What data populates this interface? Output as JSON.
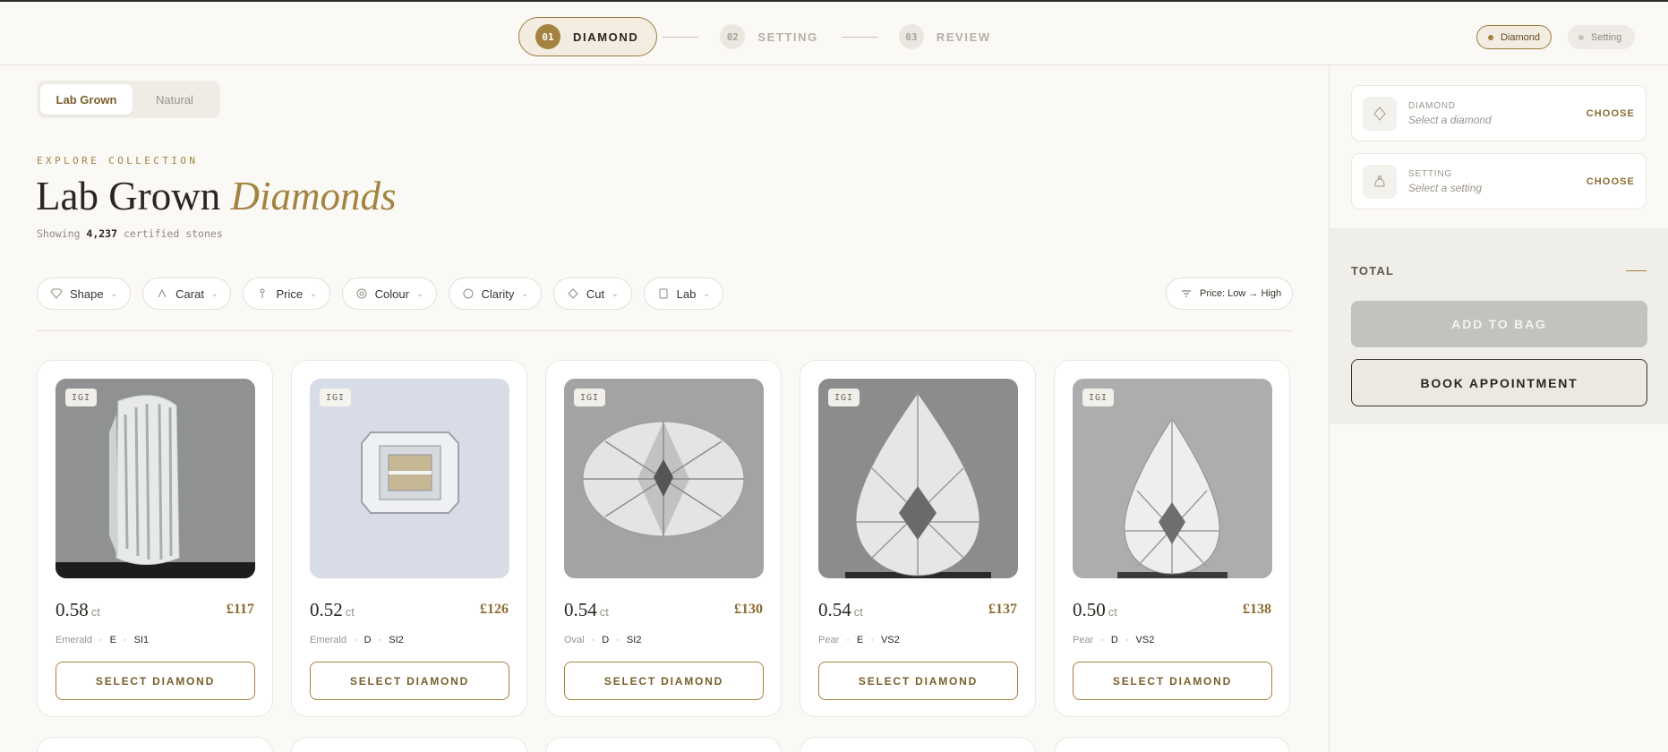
{
  "stepper": {
    "steps": [
      {
        "num": "01",
        "label": "DIAMOND"
      },
      {
        "num": "02",
        "label": "SETTING"
      },
      {
        "num": "03",
        "label": "REVIEW"
      }
    ]
  },
  "progress_pills": {
    "diamond": "Diamond",
    "setting": "Setting"
  },
  "type_toggle": {
    "lab": "Lab Grown",
    "natural": "Natural"
  },
  "header": {
    "eyebrow": "EXPLORE COLLECTION",
    "title_plain": "Lab Grown",
    "title_italic": "Diamonds",
    "subtitle_prefix": "Showing",
    "subtitle_count": "4,237",
    "subtitle_suffix": "certified stones"
  },
  "filters": [
    "Shape",
    "Carat",
    "Price",
    "Colour",
    "Clarity",
    "Cut",
    "Lab"
  ],
  "sort": {
    "label": "Price: Low → High"
  },
  "cards": [
    {
      "badge": "IGI",
      "carat": "0.58",
      "unit": "ct",
      "price": "£117",
      "shape": "Emerald",
      "colour": "E",
      "clarity": "SI1",
      "button": "SELECT DIAMOND",
      "bg": "#8f9193"
    },
    {
      "badge": "IGI",
      "carat": "0.52",
      "unit": "ct",
      "price": "£126",
      "shape": "Emerald",
      "colour": "D",
      "clarity": "SI2",
      "button": "SELECT DIAMOND",
      "bg": "#d8dce6"
    },
    {
      "badge": "IGI",
      "carat": "0.54",
      "unit": "ct",
      "price": "£130",
      "shape": "Oval",
      "colour": "D",
      "clarity": "SI2",
      "button": "SELECT DIAMOND",
      "bg": "#a3a3a3"
    },
    {
      "badge": "IGI",
      "carat": "0.54",
      "unit": "ct",
      "price": "£137",
      "shape": "Pear",
      "colour": "E",
      "clarity": "VS2",
      "button": "SELECT DIAMOND",
      "bg": "#8c8c8c"
    },
    {
      "badge": "IGI",
      "carat": "0.50",
      "unit": "ct",
      "price": "£138",
      "shape": "Pear",
      "colour": "D",
      "clarity": "VS2",
      "button": "SELECT DIAMOND",
      "bg": "#adadad"
    }
  ],
  "panel": {
    "diamond": {
      "label": "DIAMOND",
      "value": "Select a diamond",
      "action": "CHOOSE"
    },
    "setting": {
      "label": "SETTING",
      "value": "Select a setting",
      "action": "CHOOSE"
    },
    "total_label": "TOTAL",
    "add_to_bag": "ADD TO BAG",
    "book": "BOOK APPOINTMENT"
  },
  "colors": {
    "accent": "#a4823f",
    "background": "#faf9f6"
  }
}
